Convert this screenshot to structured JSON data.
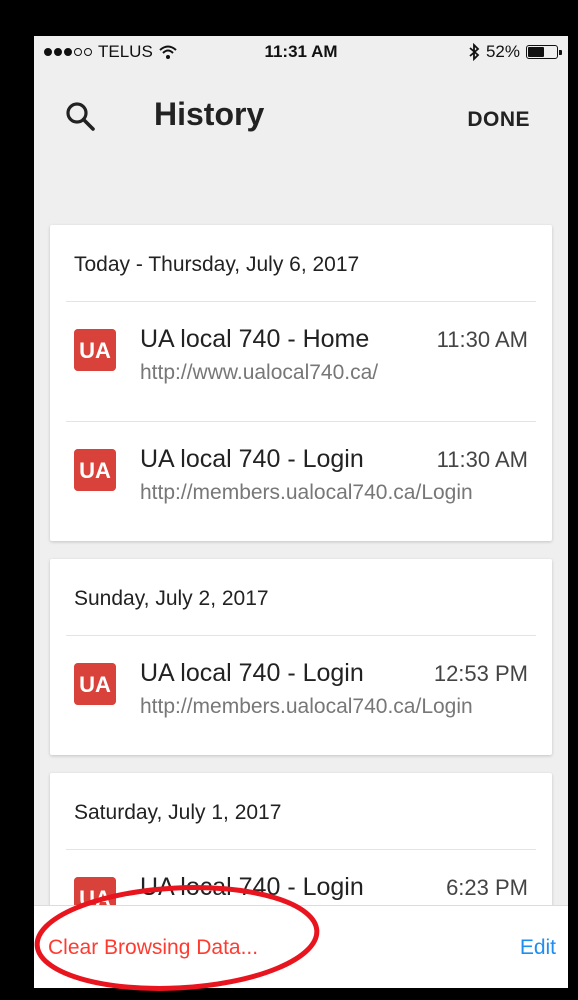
{
  "status_bar": {
    "carrier": "TELUS",
    "time": "11:31 AM",
    "battery": "52%",
    "battery_level": 0.52,
    "signal_bars": 3,
    "signal_total": 5
  },
  "header": {
    "title": "History",
    "done_label": "DONE",
    "search_icon": "search-icon"
  },
  "groups": [
    {
      "date": "Today - Thursday, July 6, 2017",
      "entries": [
        {
          "title": "UA local 740 - Home",
          "time": "11:30 AM",
          "url": "http://www.ualocal740.ca/"
        },
        {
          "title": "UA local 740 - Login",
          "time": "11:30 AM",
          "url": "http://members.ualocal740.ca/Login"
        }
      ]
    },
    {
      "date": "Sunday, July 2, 2017",
      "entries": [
        {
          "title": "UA local 740 - Login",
          "time": "12:53 PM",
          "url": "http://members.ualocal740.ca/Login"
        }
      ]
    },
    {
      "date": "Saturday, July 1, 2017",
      "entries": [
        {
          "title": "UA local 740 - Login",
          "time": "6:23 PM",
          "url": ""
        }
      ]
    }
  ],
  "favicon_text": "UA",
  "toolbar": {
    "clear_label": "Clear Browsing Data...",
    "edit_label": "Edit"
  },
  "colors": {
    "favicon": "#d9423b",
    "clear": "#ff3b30",
    "edit": "#1e8ef0",
    "annotation": "#e8141e"
  }
}
